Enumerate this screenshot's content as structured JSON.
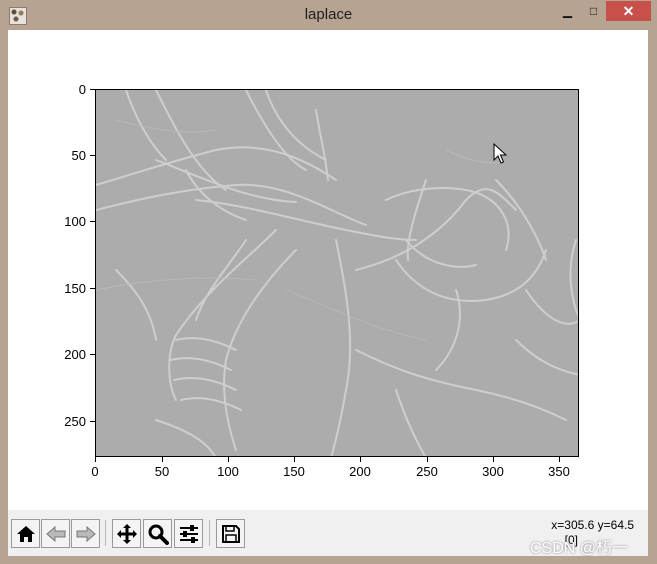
{
  "window": {
    "title": "laplace",
    "minimize_glyph": "▁",
    "maximize_glyph": "□",
    "close_glyph": "✕"
  },
  "plot": {
    "y_ticks": [
      "0",
      "50",
      "100",
      "150",
      "200",
      "250"
    ],
    "x_ticks": [
      "0",
      "50",
      "100",
      "150",
      "200",
      "250",
      "300",
      "350"
    ],
    "image_background": "#acacac",
    "edge_color": "#d8d8d8"
  },
  "toolbar": {
    "buttons": [
      {
        "name": "home-button",
        "icon": "home-icon"
      },
      {
        "name": "back-button",
        "icon": "arrow-left-icon"
      },
      {
        "name": "forward-button",
        "icon": "arrow-right-icon"
      },
      {
        "name": "pan-button",
        "icon": "move-icon"
      },
      {
        "name": "zoom-button",
        "icon": "search-icon"
      },
      {
        "name": "configure-subplots-button",
        "icon": "sliders-icon"
      },
      {
        "name": "save-button",
        "icon": "floppy-icon"
      }
    ],
    "coords_text": "x=305.6 y=64.5",
    "pixel_value_text": "[0]"
  },
  "watermark": "CSDN @朽一"
}
